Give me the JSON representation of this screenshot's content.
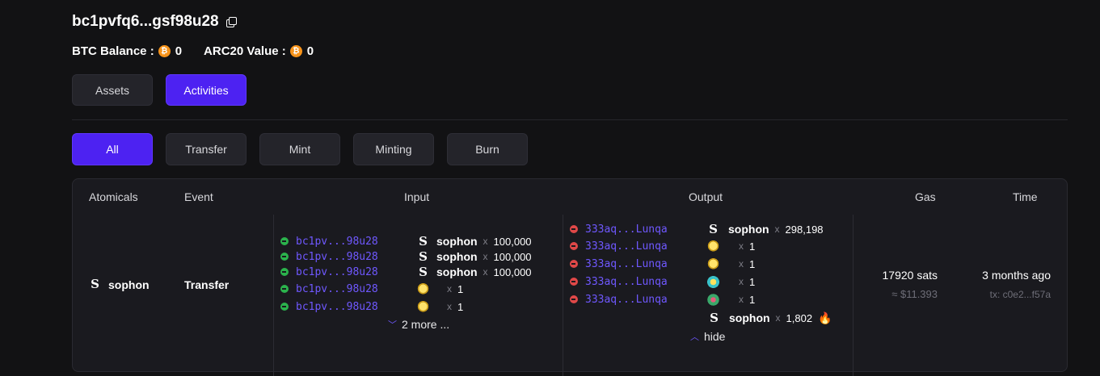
{
  "wallet": {
    "address": "bc1pvfq6...gsf98u28"
  },
  "balances": {
    "btc_label": "BTC Balance :",
    "btc_value": "0",
    "arc20_label": "ARC20 Value :",
    "arc20_value": "0"
  },
  "tabs": [
    {
      "label": "Assets",
      "active": false
    },
    {
      "label": "Activities",
      "active": true
    }
  ],
  "filters": [
    {
      "label": "All",
      "active": true
    },
    {
      "label": "Transfer",
      "active": false
    },
    {
      "label": "Mint",
      "active": false
    },
    {
      "label": "Minting",
      "active": false
    },
    {
      "label": "Burn",
      "active": false
    }
  ],
  "table": {
    "headers": {
      "atomicals": "Atomicals",
      "event": "Event",
      "input": "Input",
      "output": "Output",
      "gas": "Gas",
      "time": "Time"
    },
    "row": {
      "atomical": "sophon",
      "event": "Transfer",
      "inputs": [
        {
          "addr": "bc1pv...98u28",
          "icon": "S",
          "token": "sophon",
          "x": "x",
          "amount": "100,000"
        },
        {
          "addr": "bc1pv...98u28",
          "icon": "S",
          "token": "sophon",
          "x": "x",
          "amount": "100,000"
        },
        {
          "addr": "bc1pv...98u28",
          "icon": "S",
          "token": "sophon",
          "x": "x",
          "amount": "100,000"
        },
        {
          "addr": "bc1pv...98u28",
          "icon": "pixel-yellow",
          "token": "",
          "x": "x",
          "amount": "1"
        },
        {
          "addr": "bc1pv...98u28",
          "icon": "pixel-yellow",
          "token": "",
          "x": "x",
          "amount": "1"
        }
      ],
      "more_label": "2 more ...",
      "outputs": [
        {
          "addr": "333aq...Lunqa",
          "icon": "S",
          "token": "sophon",
          "x": "x",
          "amount": "298,198"
        },
        {
          "addr": "333aq...Lunqa",
          "icon": "pixel-yellow",
          "token": "",
          "x": "x",
          "amount": "1"
        },
        {
          "addr": "333aq...Lunqa",
          "icon": "pixel-yellow",
          "token": "",
          "x": "x",
          "amount": "1"
        },
        {
          "addr": "333aq...Lunqa",
          "icon": "pixel-teal",
          "token": "",
          "x": "x",
          "amount": "1"
        },
        {
          "addr": "333aq...Lunqa",
          "icon": "pixel-pink",
          "token": "",
          "x": "x",
          "amount": "1"
        }
      ],
      "burn": {
        "icon": "S",
        "token": "sophon",
        "x": "x",
        "amount": "1,802"
      },
      "hide_label": "hide",
      "gas": "17920 sats",
      "gas_usd": "≈ $11.393",
      "time": "3 months ago",
      "tx": "tx: c0e2...f57a"
    }
  },
  "colors": {
    "accent": "#4d22f2",
    "link": "#6f58ff",
    "in_dot": "#2bb24c",
    "out_dot": "#e04848",
    "btc": "#f7931a"
  }
}
